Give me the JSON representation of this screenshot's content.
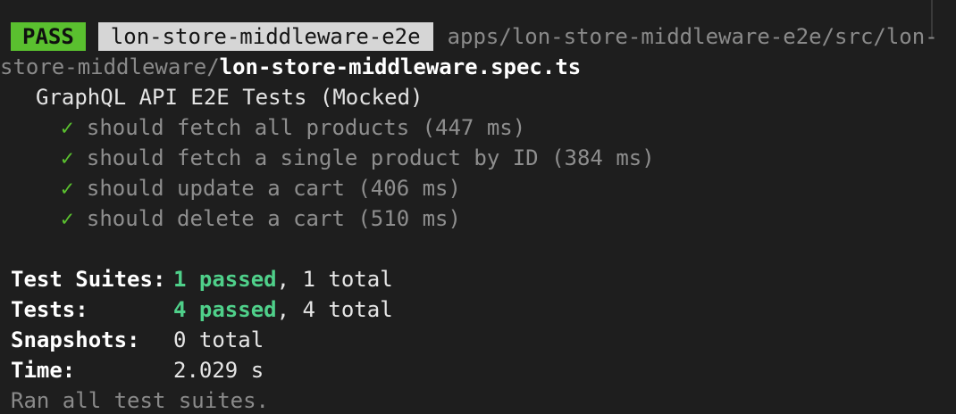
{
  "header": {
    "status": "PASS",
    "project": "lon-store-middleware-e2e",
    "path_prefix": "apps/lon-store-middleware-e2e/src/lon-",
    "path_prefix_cont": "store-middleware/",
    "file_name": "lon-store-middleware.spec.ts"
  },
  "suite": {
    "title": "GraphQL API E2E Tests (Mocked)",
    "tests": [
      {
        "check": "✓",
        "name": "should fetch all products (447 ms)"
      },
      {
        "check": "✓",
        "name": "should fetch a single product by ID (384 ms)"
      },
      {
        "check": "✓",
        "name": "should update a cart (406 ms)"
      },
      {
        "check": "✓",
        "name": "should delete a cart (510 ms)"
      }
    ]
  },
  "summary": {
    "suites": {
      "label": "Test Suites:",
      "passed": "1 passed",
      "rest": ", 1 total"
    },
    "tests": {
      "label": "Tests:",
      "passed": "4 passed",
      "rest": ", 4 total"
    },
    "snapshots": {
      "label": "Snapshots:",
      "value": "0 total"
    },
    "time": {
      "label": "Time:",
      "value": "2.029 s"
    },
    "footer": "Ran all test suites."
  },
  "colors": {
    "background": "#1e1e1e",
    "pass_badge": "#5ac02f",
    "passed_text": "#4fd08a"
  }
}
